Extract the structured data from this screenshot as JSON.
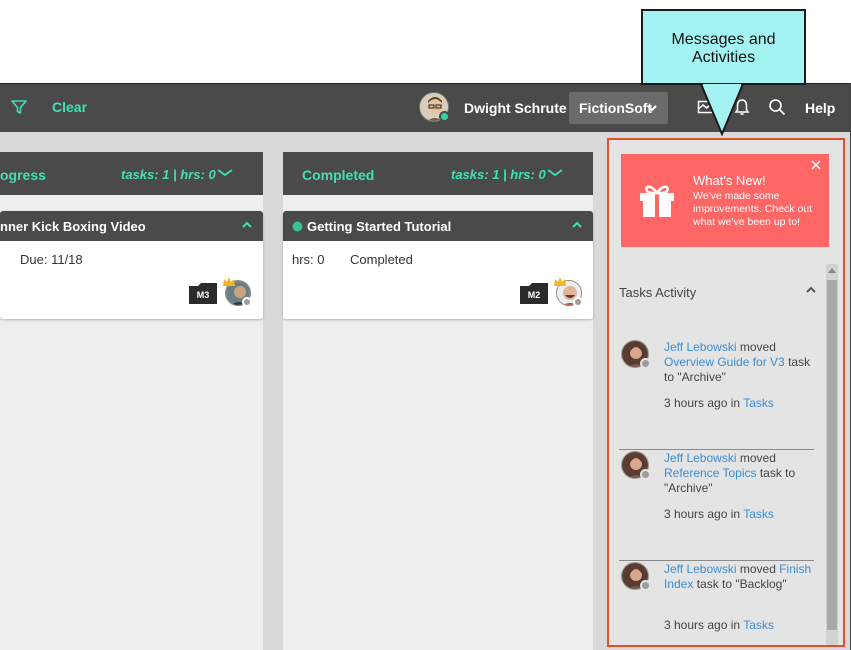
{
  "callout": {
    "line1": "Messages and",
    "line2": "Activities"
  },
  "topbar": {
    "clear_label": "Clear",
    "user_name": "Dwight Schrute",
    "org_name": "FictionSoft",
    "help_label": "Help",
    "accent_color": "#3fe0b5"
  },
  "columns": [
    {
      "title": "ogress",
      "stats": "tasks: 1 | hrs: 0",
      "card": {
        "title": "nner Kick Boxing Video",
        "due": "Due: 11/18",
        "milestone": "M3"
      }
    },
    {
      "title": "Completed",
      "stats": "tasks: 1 | hrs: 0",
      "card": {
        "title": "Getting Started Tutorial",
        "hrs": "hrs: 0",
        "status": "Completed",
        "milestone": "M2"
      }
    }
  ],
  "whats_new": {
    "title": "What's New!",
    "body": "We've made some improvements. Check out what we've been up to!",
    "bg_color": "#ff6666"
  },
  "activity": {
    "header": "Tasks Activity",
    "items": [
      {
        "user": "Jeff Lebowski",
        "verb": "moved",
        "task": "Overview Guide for V3",
        "mid": "task to",
        "dest": "\"Archive\"",
        "time": "3 hours ago in",
        "location": "Tasks"
      },
      {
        "user": "Jeff Lebowski",
        "verb": "moved",
        "task": "Reference Topics",
        "mid": "task to",
        "dest": "\"Archive\"",
        "time": "3 hours ago in",
        "location": "Tasks"
      },
      {
        "user": "Jeff Lebowski",
        "verb": "moved",
        "task": "Finish Index",
        "mid": "task to",
        "dest": "\"Backlog\"",
        "time": "3 hours ago in",
        "location": "Tasks"
      }
    ]
  },
  "icons": [
    "filter-icon",
    "messages-icon",
    "bell-icon",
    "search-icon",
    "gift-icon",
    "close-icon",
    "chevron-down-icon",
    "chevron-up-icon"
  ]
}
